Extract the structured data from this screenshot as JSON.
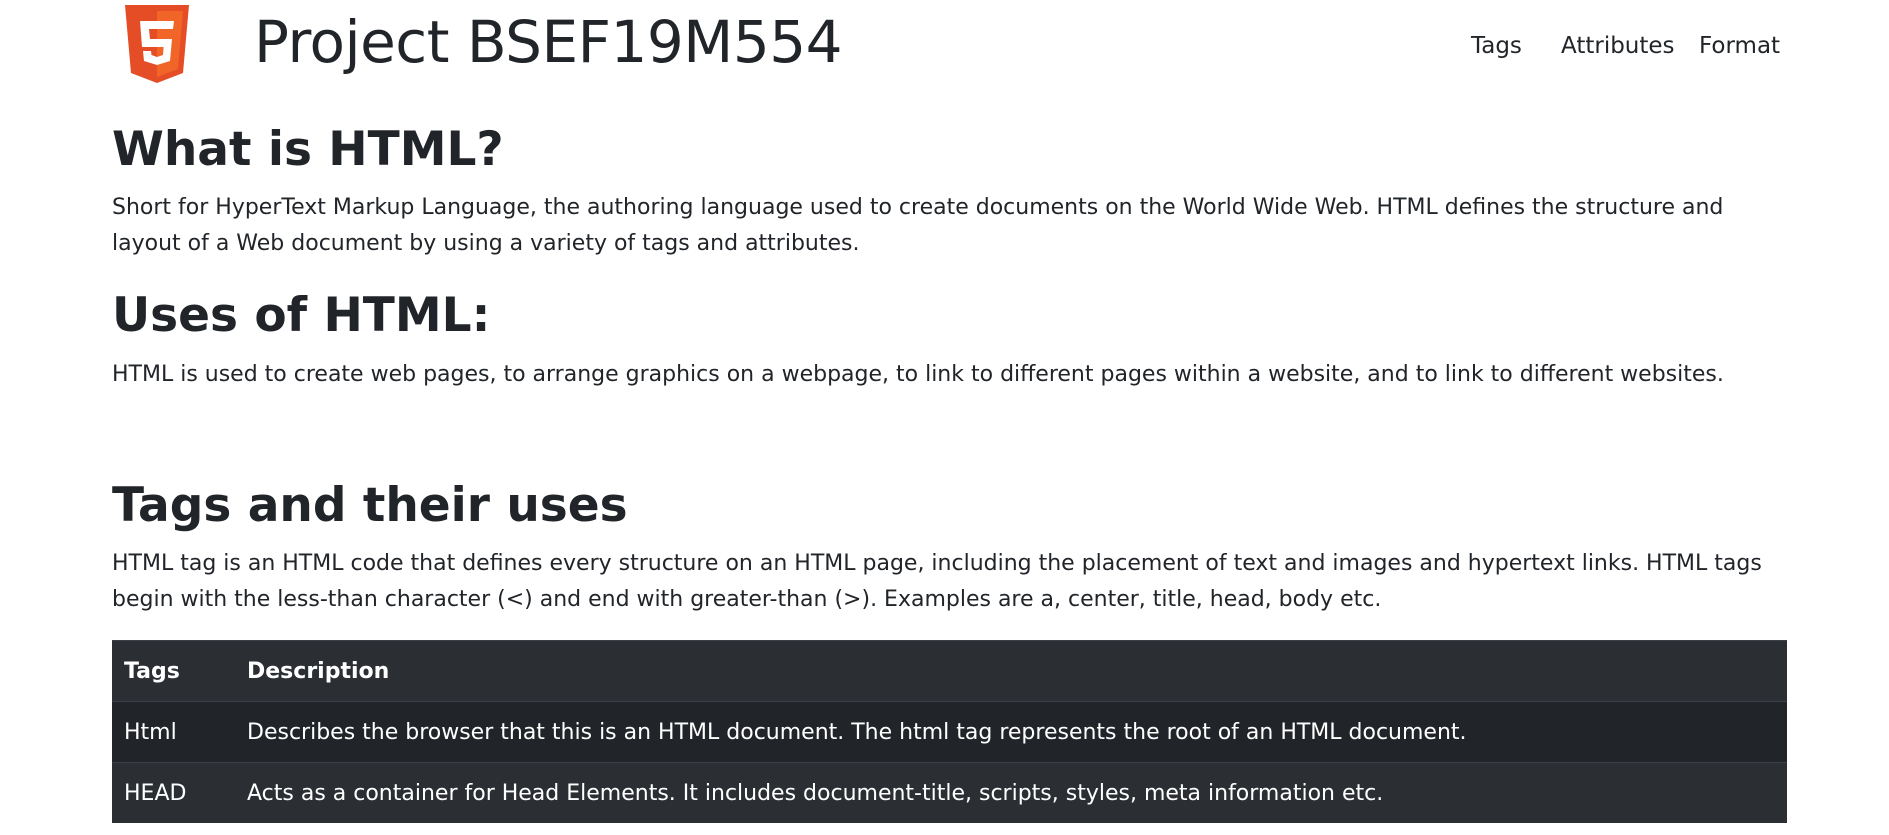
{
  "header": {
    "brand": "Project BSEF19M554",
    "logo_color": "#E44D26",
    "logo_glyph": "5",
    "nav": [
      {
        "label": "Tags"
      },
      {
        "label": "Attributes"
      },
      {
        "label": "Format"
      }
    ]
  },
  "sections": {
    "what": {
      "heading": "What is HTML?",
      "text": "Short for HyperText Markup Language, the authoring language used to create documents on the World Wide Web. HTML defines the structure and layout of a Web document by using a variety of tags and attributes."
    },
    "uses": {
      "heading": "Uses of HTML:",
      "text": "HTML is used to create web pages, to arrange graphics on a webpage, to link to different pages within a website, and to link to different websites."
    },
    "tags": {
      "heading": "Tags and their uses",
      "text": "HTML tag is an HTML code that defines every structure on an HTML page, including the placement of text and images and hypertext links. HTML tags begin with the less-than character (<) and end with greater-than (>). Examples are a, center, title, head, body etc."
    }
  },
  "table": {
    "headers": [
      "Tags",
      "Description"
    ],
    "rows": [
      [
        "Html",
        "Describes the browser that this is an HTML document. The html tag represents the root of an HTML document."
      ],
      [
        "HEAD",
        "Acts as a container for Head Elements. It includes document-title, scripts, styles, meta information etc."
      ]
    ]
  }
}
